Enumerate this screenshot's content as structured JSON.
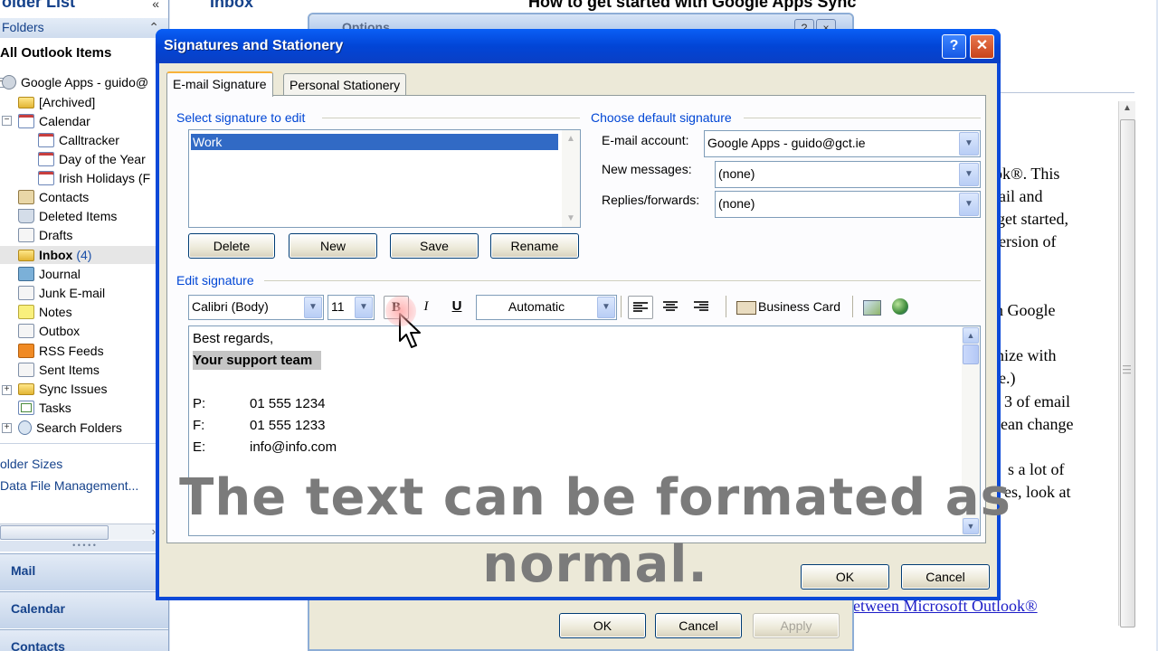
{
  "folder_pane": {
    "header": "older List",
    "sub_header": "Folders",
    "all_items": "All Outlook Items",
    "tree": [
      {
        "label": "Google Apps - guido@"
      },
      {
        "label": "[Archived]"
      },
      {
        "label": "Calendar"
      },
      {
        "label": "Calltracker"
      },
      {
        "label": "Day of the Year"
      },
      {
        "label": "Irish Holidays (F"
      },
      {
        "label": "Contacts"
      },
      {
        "label": "Deleted Items"
      },
      {
        "label": "Drafts"
      },
      {
        "label": "Inbox",
        "count": "(4)"
      },
      {
        "label": "Journal"
      },
      {
        "label": "Junk E-mail"
      },
      {
        "label": "Notes"
      },
      {
        "label": "Outbox"
      },
      {
        "label": "RSS Feeds"
      },
      {
        "label": "Sent Items"
      },
      {
        "label": "Sync Issues"
      },
      {
        "label": "Tasks"
      },
      {
        "label": "Search Folders"
      }
    ],
    "links": [
      "older Sizes",
      "Data File Management..."
    ],
    "nav_buttons": [
      "Mail",
      "Calendar",
      "Contacts"
    ]
  },
  "inbox_header": "Inbox",
  "reading_pane": {
    "title": "How to get started with Google Apps Sync",
    "fragments": [
      "ook®. This",
      "ail and",
      "get started,",
      "ersion of",
      "ith Google",
      "onize with",
      "e.)",
      "3 of email",
      "ean change",
      "s a lot of",
      "es, look at"
    ],
    "link": "between Microsoft Outlook®",
    "bottom_fragment": "... ... ... ... ..."
  },
  "options_dialog": {
    "title": "Options",
    "ok": "OK",
    "cancel": "Cancel",
    "apply": "Apply"
  },
  "sig_dialog": {
    "title": "Signatures and Stationery",
    "tabs": [
      "E-mail Signature",
      "Personal Stationery"
    ],
    "select_label": "Select signature to edit",
    "signatures": [
      "Work"
    ],
    "buttons": {
      "delete": "Delete",
      "new": "New",
      "save": "Save",
      "rename": "Rename"
    },
    "default_label": "Choose default signature",
    "email_account_label": "E-mail account:",
    "email_account_value": "Google Apps - guido@gct.ie",
    "new_messages_label": "New messages:",
    "new_messages_value": "(none)",
    "replies_label": "Replies/forwards:",
    "replies_value": "(none)",
    "edit_label": "Edit signature",
    "font": "Calibri (Body)",
    "size": "11",
    "bold": "B",
    "italic": "I",
    "underline": "U",
    "color": "Automatic",
    "business_card": "Business Card",
    "editor_lines": {
      "l1": "Best regards,",
      "l2": "Your support team",
      "p_label": "P:",
      "p_val": "01 555 1234",
      "f_label": "F:",
      "f_val": "01 555 1233",
      "e_label": "E:",
      "e_val": "info@info.com"
    },
    "ok": "OK",
    "cancel": "Cancel"
  },
  "caption": {
    "line1": "The text can be formated as",
    "line2": "normal."
  }
}
